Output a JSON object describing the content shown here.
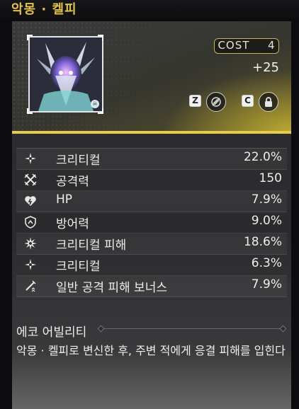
{
  "title": "악몽 · 켈피",
  "header": {
    "cost_label": "COST",
    "cost_value": "4",
    "level": "+25",
    "key_z": "Z",
    "key_c": "C"
  },
  "stats": [
    {
      "icon": "crit-rate-icon",
      "name": "크리티컬",
      "value": "22.0%"
    },
    {
      "icon": "attack-icon",
      "name": "공격력",
      "value": "150"
    },
    {
      "icon": "hp-icon",
      "name": "HP",
      "value": "7.9%"
    },
    {
      "icon": "defense-icon",
      "name": "방어력",
      "value": "9.0%"
    },
    {
      "icon": "crit-dmg-icon",
      "name": "크리티컬 피해",
      "value": "18.6%"
    },
    {
      "icon": "crit-rate-icon",
      "name": "크리티컬",
      "value": "6.3%"
    },
    {
      "icon": "basic-attack-icon",
      "name": "일반 공격 피해 보너스",
      "value": "7.9%"
    }
  ],
  "ability": {
    "title": "에코 어빌리티",
    "description": "악몽 · 켈피로 변신한 후, 주변 적에게 응결 피해를 입힌다"
  },
  "colors": {
    "accent": "#e2c24f",
    "panel": "#2e2e31"
  }
}
